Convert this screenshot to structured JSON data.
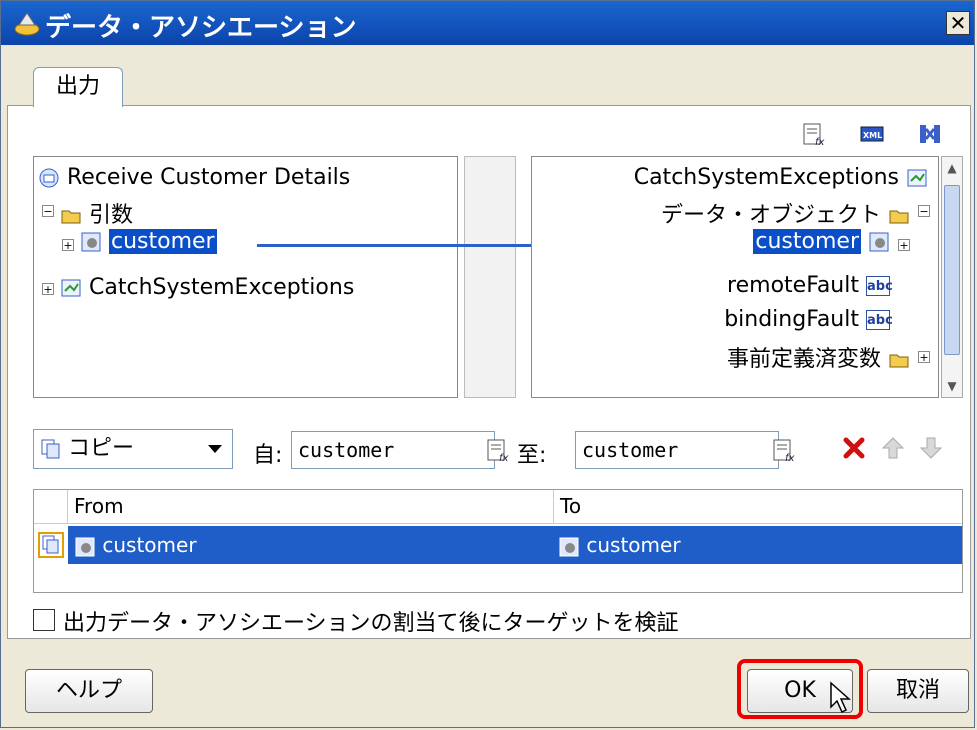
{
  "window": {
    "title": "データ・アソシエーション",
    "close_label": "✕"
  },
  "tabs": [
    {
      "label": "出力"
    }
  ],
  "left_tree": {
    "root": "Receive Customer Details",
    "args_folder": "引数",
    "customer": "customer",
    "catch": "CatchSystemExceptions"
  },
  "right_tree": {
    "root": "CatchSystemExceptions",
    "data_objects": "データ・オブジェクト",
    "customer": "customer",
    "remote_fault": "remoteFault",
    "binding_fault": "bindingFault",
    "predefined": "事前定義済変数",
    "abc_label": "abc"
  },
  "copy_rule": {
    "operation": "コピー",
    "from_label": "自:",
    "from_value": "customer",
    "to_label": "至:",
    "to_value": "customer"
  },
  "grid": {
    "columns": [
      "From",
      "To"
    ],
    "rows": [
      {
        "from": "customer",
        "to": "customer"
      }
    ]
  },
  "validate_checkbox": {
    "label": "出力データ・アソシエーションの割当て後にターゲットを検証",
    "checked": false
  },
  "buttons": {
    "help": "ヘルプ",
    "ok": "OK",
    "cancel": "取消"
  },
  "colors": {
    "selection": "#1f5ec8",
    "titlebar": "#0c44ab",
    "highlight": "#e00000"
  }
}
